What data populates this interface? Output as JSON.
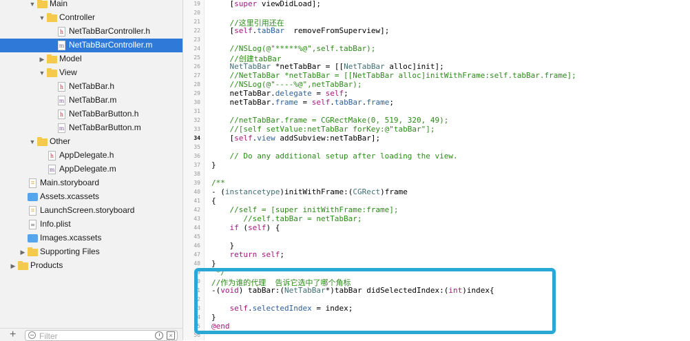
{
  "navigator": {
    "items": [
      {
        "label": "Main",
        "kind": "folder",
        "expanded": true
      },
      {
        "label": "Controller",
        "kind": "folder",
        "expanded": true
      },
      {
        "label": "NetTabBarController.h",
        "kind": "h"
      },
      {
        "label": "NetTabBarController.m",
        "kind": "m",
        "selected": true
      },
      {
        "label": "Model",
        "kind": "folder",
        "expanded": false
      },
      {
        "label": "View",
        "kind": "folder",
        "expanded": true
      },
      {
        "label": "NetTabBar.h",
        "kind": "h"
      },
      {
        "label": "NetTabBar.m",
        "kind": "m"
      },
      {
        "label": "NetTabBarButton.h",
        "kind": "h"
      },
      {
        "label": "NetTabBarButton.m",
        "kind": "m"
      },
      {
        "label": "Other",
        "kind": "folder",
        "expanded": true
      },
      {
        "label": "AppDelegate.h",
        "kind": "h"
      },
      {
        "label": "AppDelegate.m",
        "kind": "m"
      },
      {
        "label": "Main.storyboard",
        "kind": "storyboard"
      },
      {
        "label": "Assets.xcassets",
        "kind": "xcassets"
      },
      {
        "label": "LaunchScreen.storyboard",
        "kind": "storyboard"
      },
      {
        "label": "Info.plist",
        "kind": "plist"
      },
      {
        "label": "Images.xcassets",
        "kind": "xcassets"
      },
      {
        "label": "Supporting Files",
        "kind": "folder",
        "expanded": false
      },
      {
        "label": "Products",
        "kind": "folder",
        "expanded": false
      }
    ],
    "filter_placeholder": "Filter",
    "add_label": "+"
  },
  "editor": {
    "line_numbers": [
      "19",
      "20",
      "21",
      "22",
      "23",
      "24",
      "25",
      "26",
      "27",
      "28",
      "29",
      "30",
      "31",
      "32",
      "33",
      "34",
      "35",
      "36",
      "37",
      "38",
      "39",
      "40",
      "41",
      "42",
      "43",
      "44",
      "45",
      "46",
      "47",
      "48",
      "49",
      "50",
      "51",
      "52",
      "53",
      "54",
      "55",
      "56"
    ],
    "active_line": "34",
    "code_lines": [
      "    [super viewDidLoad];",
      "",
      "    //这里引用还在",
      "    [self.tabBar  removeFromSuperview];",
      "",
      "    //NSLog(@\"*****%@\",self.tabBar);",
      "    //创建tabBar",
      "    NetTabBar *netTabBar = [[NetTabBar alloc]init];",
      "    //NetTabBar *netTabBar = [[NetTabBar alloc]initWithFrame:self.tabBar.frame];",
      "    //NSLog(@\"----%@\",netTabBar);",
      "    netTabBar.delegate = self;",
      "    netTabBar.frame = self.tabBar.frame;",
      "",
      "    //netTabBar.frame = CGRectMake(0, 519, 320, 49);",
      "    //[self setValue:netTabBar forKey:@\"tabBar\"];",
      "    [self.view addSubview:netTabBar];",
      "",
      "    // Do any additional setup after loading the view.",
      "}",
      "",
      "/**",
      "- (instancetype)initWithFrame:(CGRect)frame",
      "{",
      "    //self = [super initWithFrame:frame];",
      "       //self.tabBar = netTabBar;",
      "    if (self) {",
      "",
      "    }",
      "    return self;",
      "}",
      " */",
      "//作为谁的代理  告诉它选中了哪个角标",
      "-(void) tabBar:(NetTabBar*)tabBar didSelectedIndex:(int)index{",
      "",
      "    self.selectedIndex = index;",
      "}",
      "@end",
      ""
    ]
  },
  "colors": {
    "selection": "#2f7ad9",
    "highlight_border": "#29a8d6",
    "comment": "#2b8a18",
    "keyword": "#a3177c",
    "type": "#3f6e74"
  }
}
